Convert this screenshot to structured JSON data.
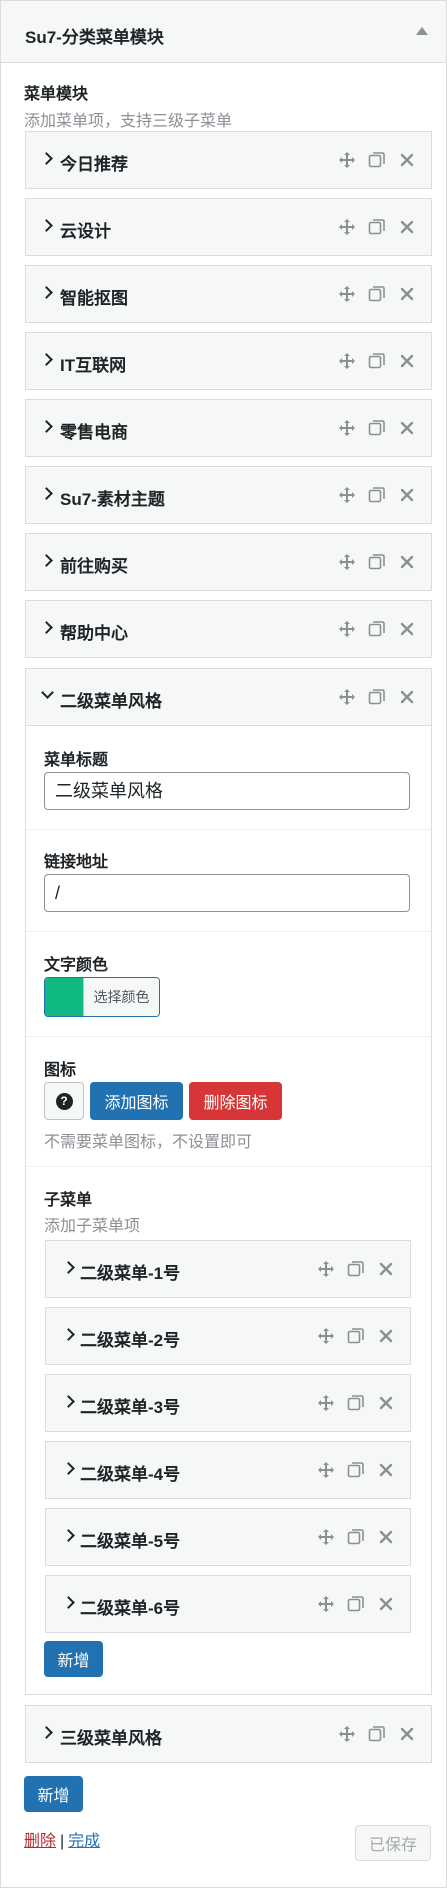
{
  "widget": {
    "title": "Su7-分类菜单模块"
  },
  "menu": {
    "label": "菜单模块",
    "description": "添加菜单项，支持三级子菜单",
    "items": [
      {
        "label": "今日推荐"
      },
      {
        "label": "云设计"
      },
      {
        "label": "智能抠图"
      },
      {
        "label": "IT互联网"
      },
      {
        "label": "零售电商"
      },
      {
        "label": "Su7-素材主题"
      },
      {
        "label": "前往购买"
      },
      {
        "label": "帮助中心"
      }
    ],
    "expanded_item": {
      "label": "二级菜单风格"
    },
    "last_item": {
      "label": "三级菜单风格"
    },
    "add_button": "新增"
  },
  "editor": {
    "title_label": "菜单标题",
    "title_value": "二级菜单风格",
    "link_label": "链接地址",
    "link_value": "/",
    "color_label": "文字颜色",
    "color_value": "#10b981",
    "color_button": "选择颜色",
    "icon_label": "图标",
    "icon_help": "?",
    "add_icon_button": "添加图标",
    "remove_icon_button": "删除图标",
    "icon_hint": "不需要菜单图标，不设置即可",
    "submenu_label": "子菜单",
    "submenu_description": "添加子菜单项",
    "submenu_items": [
      {
        "label": "二级菜单-1号"
      },
      {
        "label": "二级菜单-2号"
      },
      {
        "label": "二级菜单-3号"
      },
      {
        "label": "二级菜单-4号"
      },
      {
        "label": "二级菜单-5号"
      },
      {
        "label": "二级菜单-6号"
      }
    ],
    "submenu_add_button": "新增"
  },
  "footer": {
    "delete_link": "删除",
    "separator": "|",
    "done_link": "完成",
    "saved_button": "已保存"
  },
  "colors": {
    "primary": "#2271b1",
    "danger": "#d63638",
    "swatch": "#10b981"
  }
}
